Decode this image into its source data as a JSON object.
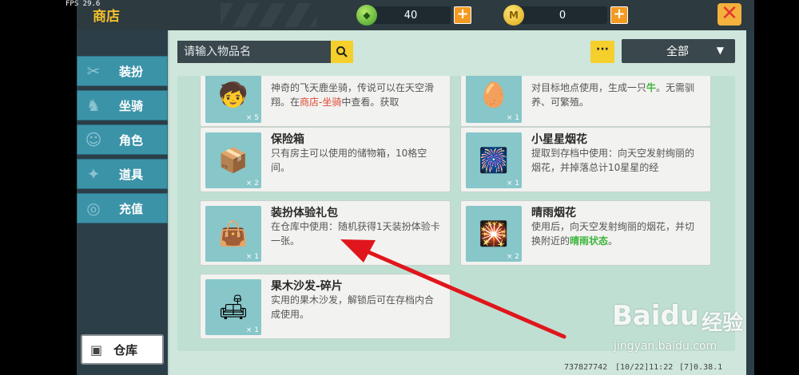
{
  "status": {
    "fps": "FPS 29.6"
  },
  "header": {
    "title": "商店",
    "gem": {
      "icon": "gem-icon",
      "amount": "40",
      "add": "+"
    },
    "coin": {
      "icon": "coin-icon",
      "amount": "0",
      "add": "+"
    },
    "close_label": "✕"
  },
  "search": {
    "placeholder": "请输入物品名",
    "icon": "search-icon"
  },
  "more_label": "···",
  "filter": {
    "selected": "全部"
  },
  "sidebar": {
    "items": [
      {
        "label": "装扮",
        "icon": "outfit-icon"
      },
      {
        "label": "坐骑",
        "icon": "mount-icon"
      },
      {
        "label": "角色",
        "icon": "character-icon"
      },
      {
        "label": "道具",
        "icon": "prop-icon"
      },
      {
        "label": "充值",
        "icon": "recharge-icon"
      }
    ],
    "warehouse": {
      "label": "仓库",
      "icon": "chest-icon"
    }
  },
  "items": {
    "i0": {
      "qty": "× 5",
      "desc_a": "神奇的飞天鹿坐骑，传说可以在天空滑翔。在",
      "desc_link": "商店-坐骑",
      "desc_b": "中查看。获取"
    },
    "i1": {
      "qty": "× 1",
      "desc_a": "对目标地点使用，生成一只",
      "desc_link": "牛",
      "desc_b": "。无需驯养、可繁殖。"
    },
    "i2": {
      "name": "保险箱",
      "qty": "× 2",
      "desc": "只有房主可以使用的储物箱，10格空间。"
    },
    "i3": {
      "name": "小星星烟花",
      "qty": "× 1",
      "desc": "提取到存档中使用：向天空发射绚丽的烟花，并掉落总计10星星的经"
    },
    "i4": {
      "name": "装扮体验礼包",
      "qty": "× 1",
      "desc": "在仓库中使用：随机获得1天装扮体验卡一张。"
    },
    "i5": {
      "name": "晴雨烟花",
      "qty": "× 2",
      "desc_a": "使用后，向天空发射绚丽的烟花，并切换附近的",
      "desc_link": "晴雨状态",
      "desc_b": "。"
    },
    "i6": {
      "name": "果木沙发-碎片",
      "qty": "× 1",
      "desc": "实用的果木沙发，解锁后可在存档内合成使用。"
    }
  },
  "footer": {
    "uid": "737827742",
    "date": "[10/22]11:22",
    "version": "[7]0.38.1"
  },
  "watermark": {
    "brand": "Baidu",
    "brand2": "经验",
    "url": "jingyan.baidu.com"
  },
  "colors": {
    "accent": "#f5cf2c",
    "sidebar": "#3b93a8",
    "panel": "#cfe6dc",
    "arrow": "#e0161c"
  }
}
